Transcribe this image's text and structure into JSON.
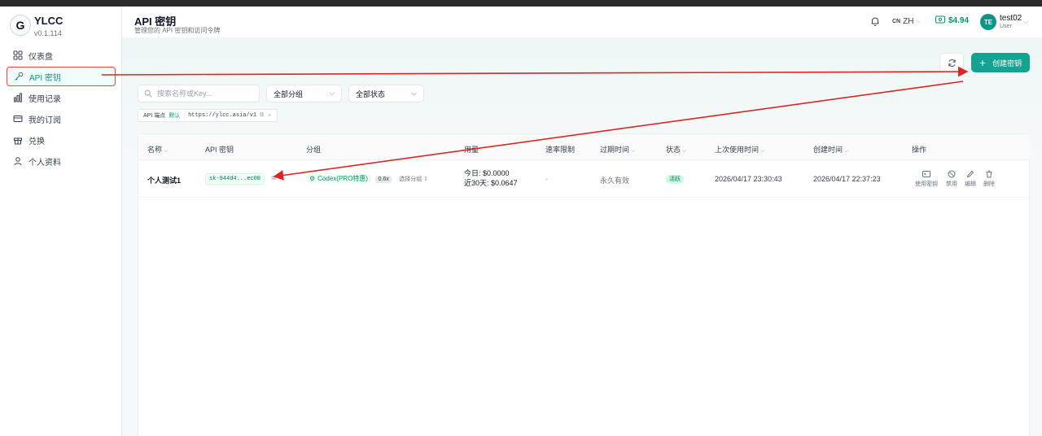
{
  "app": {
    "name": "YLCC",
    "version": "v0.1.114",
    "logo_letter": "G"
  },
  "sidebar": {
    "items": [
      {
        "label": "仪表盘",
        "icon": "dashboard-icon"
      },
      {
        "label": "API 密钥",
        "icon": "key-icon",
        "active": true
      },
      {
        "label": "使用记录",
        "icon": "bar-chart-icon"
      },
      {
        "label": "我的订阅",
        "icon": "card-icon"
      },
      {
        "label": "兑换",
        "icon": "gift-icon"
      },
      {
        "label": "个人资料",
        "icon": "user-icon"
      }
    ]
  },
  "header": {
    "title": "API 密钥",
    "subtitle": "管理您的 API 密钥和访问令牌",
    "lang_code": "CN",
    "lang_label": "ZH",
    "balance": "$4.94",
    "avatar_initials": "TE",
    "username": "test02",
    "role": "User"
  },
  "toolbar": {
    "create_label": "创建密钥",
    "search_placeholder": "搜索名称或Key...",
    "group_filter": "全部分组",
    "status_filter": "全部状态"
  },
  "endpoint": {
    "label": "API 端点",
    "default_tag": "默认",
    "url": "https://ylcc.asia/v1"
  },
  "table": {
    "columns": [
      "名称",
      "API 密钥",
      "分组",
      "用量",
      "速率限制",
      "过期时间",
      "状态",
      "上次使用时间",
      "创建时间",
      "操作"
    ],
    "rows": [
      {
        "name": "个人测试1",
        "key": "sk-944d4...ec00",
        "group": "Codex(PRO特惠)",
        "group_rate": "0.6x",
        "group_select": "选择分组",
        "usage_today": "今日:",
        "usage_today_val": "$0.0000",
        "usage_30d": "近30天:",
        "usage_30d_val": "$0.0647",
        "rate_limit": "-",
        "expires": "永久有效",
        "status": "活跃",
        "last_used": "2026/04/17 23:30:43",
        "created": "2026/04/17 22:37:23",
        "actions": [
          "使用密钥",
          "禁用",
          "编辑",
          "删除"
        ]
      }
    ]
  },
  "colors": {
    "accent": "#14a390",
    "annotation": "#dc2626"
  }
}
